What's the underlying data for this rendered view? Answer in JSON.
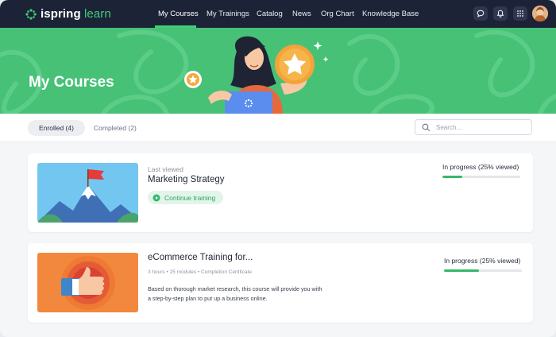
{
  "brand": {
    "name_bold": "ispring",
    "name_light": "learn"
  },
  "nav": {
    "items": [
      {
        "label": "My Courses"
      },
      {
        "label": "My Trainings"
      },
      {
        "label": "Catalog"
      },
      {
        "label": "News"
      },
      {
        "label": "Org Chart"
      },
      {
        "label": "Knowledge Base"
      }
    ],
    "active_index": 0,
    "icons": [
      "chat-icon",
      "bell-icon",
      "apps-grid-icon"
    ]
  },
  "banner": {
    "title": "My Courses"
  },
  "tabs": [
    {
      "label": "Enrolled (4)"
    },
    {
      "label": "Completed (2)"
    }
  ],
  "search": {
    "placeholder": "Search..."
  },
  "courses": [
    {
      "last_viewed": "Last viewed",
      "title": "Marketing Strategy",
      "action_label": "Continue training",
      "status": "In progress (25% viewed)",
      "progress": 0.25,
      "thumbnail": "mountain-flag"
    },
    {
      "title": "eCommerce Training for...",
      "meta": "3 hours • 25 modules • Completion Certificate",
      "description": "Based on thorough market research, this course will provide you with a step-by-step plan to put up a business online.",
      "status": "In progress (25% viewed)",
      "progress": 0.45,
      "thumbnail": "thumbs-up"
    }
  ],
  "colors": {
    "nav_bg": "#1d2336",
    "accent": "#3ecf78",
    "banner": "#46c176",
    "progress": "#34b86a"
  }
}
